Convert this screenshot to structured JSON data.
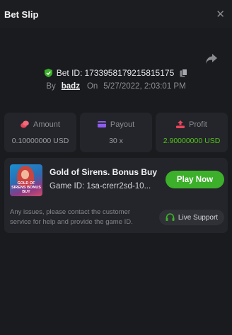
{
  "header": {
    "title": "Bet Slip",
    "close_glyph": "✕"
  },
  "bet": {
    "id_label": "Bet ID:",
    "id_value": "1733958179215815175",
    "by_label": "By",
    "user": "badz",
    "on_label": "On",
    "timestamp": "5/27/2022, 2:03:01 PM"
  },
  "stats": {
    "amount": {
      "label": "Amount",
      "value": "0.10000000 USD"
    },
    "payout": {
      "label": "Payout",
      "value": "30 x"
    },
    "profit": {
      "label": "Profit",
      "value": "2.90000000 USD"
    }
  },
  "game": {
    "name": "Gold of Sirens. Bonus Buy",
    "id_text": "Game ID: 1sa-crerr2sd-10...",
    "thumb_text": "GOLD OF SIRENS BONUS BUY",
    "play_label": "Play Now",
    "note": "Any issues, please contact the customer service for help and provide the game ID.",
    "support_label": "Live Support"
  },
  "colors": {
    "background": "#1a1b1e",
    "card": "#24252a",
    "accent_green": "#3cb02a",
    "profit_green": "#52c41a",
    "amount_icon": "#e8455b",
    "payout_icon": "#8e5cf0",
    "profit_icon": "#e8455b"
  },
  "icons": [
    "close-icon",
    "share-icon",
    "shield-check-icon",
    "copy-icon",
    "coins-icon",
    "card-icon",
    "profit-icon",
    "headset-icon"
  ]
}
